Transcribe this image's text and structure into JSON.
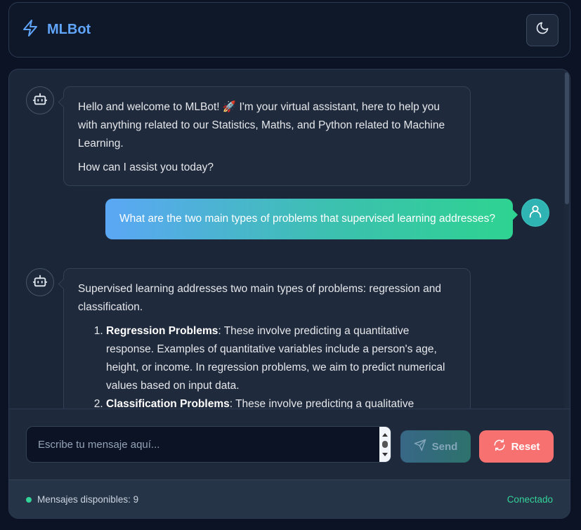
{
  "header": {
    "title": "MLBot",
    "logo_icon": "lightning-icon",
    "theme_toggle_icon": "moon-icon"
  },
  "messages": [
    {
      "role": "bot",
      "paragraphs": [
        "Hello and welcome to MLBot! 🚀 I'm your virtual assistant, here to help you with anything related to our Statistics, Maths, and Python related to Machine Learning.",
        "How can I assist you today?"
      ]
    },
    {
      "role": "user",
      "text": "What are the two main types of problems that supervised learning addresses?"
    },
    {
      "role": "bot",
      "intro": "Supervised learning addresses two main types of problems: regression and classification.",
      "list": [
        {
          "title": "Regression Problems",
          "text": ": These involve predicting a quantitative response. Examples of quantitative variables include a person's age, height, or income. In regression problems, we aim to predict numerical values based on input data."
        },
        {
          "title": "Classification Problems",
          "text": ": These involve predicting a qualitative"
        }
      ]
    }
  ],
  "composer": {
    "placeholder": "Escribe tu mensaje aquí...",
    "value": "",
    "send_label": "Send",
    "reset_label": "Reset"
  },
  "status": {
    "messages_available": "Mensajes disponibles: 9",
    "connection": "Conectado"
  },
  "colors": {
    "accent": "#60a5fa",
    "reset": "#f87171",
    "connected": "#34d399"
  }
}
